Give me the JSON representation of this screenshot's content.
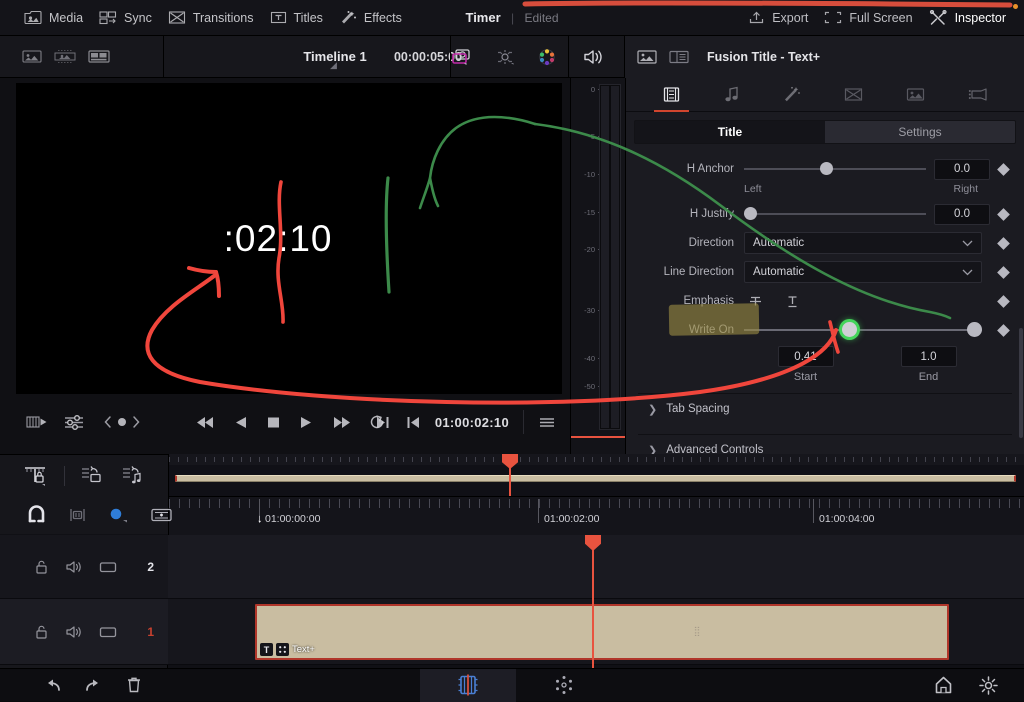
{
  "topbar": {
    "menu": [
      {
        "label": "Media",
        "icon": "media-icon"
      },
      {
        "label": "Sync",
        "icon": "sync-icon"
      },
      {
        "label": "Transitions",
        "icon": "transitions-icon"
      },
      {
        "label": "Titles",
        "icon": "titles-icon"
      },
      {
        "label": "Effects",
        "icon": "effects-icon"
      }
    ],
    "project_name": "Timer",
    "project_status": "Edited",
    "right": [
      {
        "label": "Export",
        "icon": "export-icon"
      },
      {
        "label": "Full Screen",
        "icon": "fullscreen-icon"
      },
      {
        "label": "Inspector",
        "icon": "inspector-icon"
      }
    ]
  },
  "bar2": {
    "timeline_name": "Timeline 1",
    "timeline_duration": "00:00:05:00",
    "inspector_title": "Fusion Title - Text+"
  },
  "viewer": {
    "timecode_overlay": ":02:10",
    "current_timecode": "01:00:02:10"
  },
  "meter": {
    "ticks": [
      "0",
      "-5",
      "-10",
      "-15",
      "-20",
      "-30",
      "-40",
      "-50"
    ]
  },
  "inspector": {
    "tabs": [
      {
        "icon": "film-strip-icon",
        "active": true
      },
      {
        "icon": "music-note-icon",
        "active": false
      },
      {
        "icon": "magic-wand-icon",
        "active": false
      },
      {
        "icon": "transition-icon",
        "active": false
      },
      {
        "icon": "image-icon",
        "active": false
      },
      {
        "icon": "camera-color-icon",
        "active": false
      }
    ],
    "segments": {
      "title": "Title",
      "settings": "Settings",
      "selected": "Title"
    },
    "controls": {
      "h_anchor": {
        "label": "H Anchor",
        "value": "0.0",
        "min_label": "Left",
        "max_label": "Right",
        "knob_pct": 42
      },
      "h_justify": {
        "label": "H Justify",
        "value": "0.0",
        "knob_pct": 0
      },
      "direction": {
        "label": "Direction",
        "value": "Automatic"
      },
      "line_direction": {
        "label": "Line Direction",
        "value": "Automatic"
      },
      "emphasis": {
        "label": "Emphasis"
      },
      "write_on": {
        "label": "Write On",
        "start_value": "0.41",
        "end_value": "1.0",
        "start_label": "Start",
        "end_label": "End",
        "start_pct": 41,
        "end_pct": 100,
        "highlighted": true
      }
    },
    "accordions": [
      {
        "label": "Tab Spacing",
        "expanded": false
      },
      {
        "label": "Advanced Controls",
        "expanded": false
      }
    ]
  },
  "timeline": {
    "ruler_marks": [
      "01:00:00:00",
      "01:00:02:00",
      "01:00:04:00"
    ],
    "tracks": [
      {
        "number": "2",
        "active": false
      },
      {
        "number": "1",
        "active": true
      }
    ],
    "clip": {
      "name": "Text+",
      "type_icon": "T",
      "fusion_icon": "fusion-icon"
    },
    "playhead_timecode": "01:00:02:10"
  },
  "bottombar": {
    "left": [
      {
        "icon": "undo-icon"
      },
      {
        "icon": "redo-icon"
      },
      {
        "icon": "trash-icon"
      }
    ],
    "pages": [
      {
        "icon": "cut-page-icon",
        "active": true
      },
      {
        "icon": "fusion-page-icon",
        "active": false
      }
    ],
    "right": [
      {
        "icon": "home-icon"
      },
      {
        "icon": "settings-gear-icon"
      }
    ]
  },
  "colors": {
    "accent_red": "#e8533f",
    "clip_fill": "#c9bda1",
    "clip_border": "#b0362a",
    "highlight_olive": "#9a8b44",
    "knob_green": "#43d45a",
    "annotation_red": "#f0463c",
    "annotation_green": "#3c8a4a"
  }
}
